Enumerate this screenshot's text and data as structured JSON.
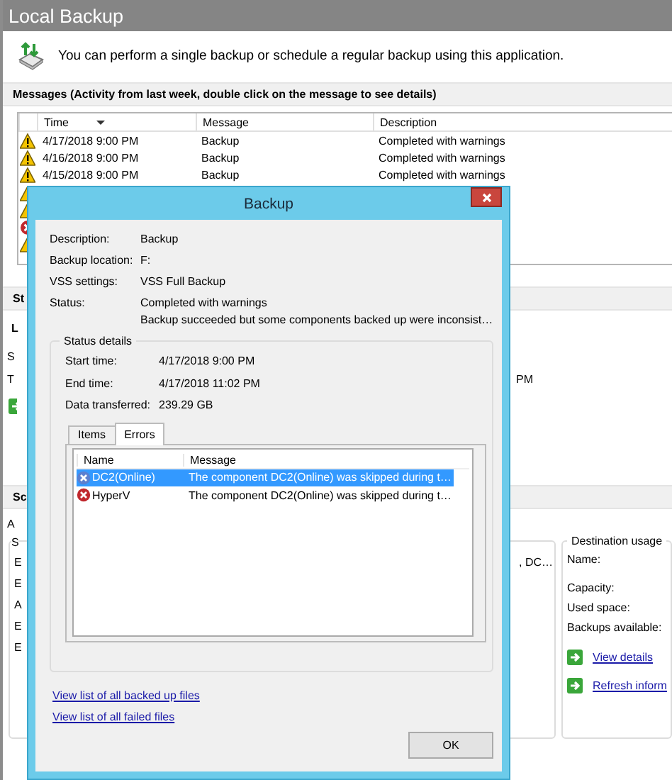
{
  "window": {
    "title": "Local Backup"
  },
  "header": {
    "text": "You can perform a single backup or schedule a regular backup using this application."
  },
  "messages": {
    "heading": "Messages (Activity from last week, double click on the message to see details)",
    "columns": [
      {
        "label": "Time",
        "sorted": true
      },
      {
        "label": "Message",
        "sorted": false
      },
      {
        "label": "Description",
        "sorted": false
      }
    ],
    "rows": [
      {
        "kind": "warning",
        "time": "4/17/2018 9:00 PM",
        "message": "Backup",
        "description": "Completed with warnings"
      },
      {
        "kind": "warning",
        "time": "4/16/2018 9:00 PM",
        "message": "Backup",
        "description": "Completed with warnings"
      },
      {
        "kind": "warning",
        "time": "4/15/2018 9:00 PM",
        "message": "Backup",
        "description": "Completed with warnings"
      },
      {
        "kind": "warning"
      },
      {
        "kind": "warning"
      },
      {
        "kind": "error"
      },
      {
        "kind": "warning"
      }
    ]
  },
  "status_section": {
    "heading": "St",
    "lines": [
      "L",
      "S",
      "T"
    ],
    "reading": "PM"
  },
  "scheduled_section": {
    "heading": "Sc",
    "line": "A",
    "group_lines": [
      "S",
      "E",
      "E",
      "A",
      "E",
      "E"
    ],
    "reading": ", DC…"
  },
  "destination": {
    "title": "Destination usage",
    "fields": [
      "Name:",
      "Capacity:",
      "Used space:",
      "Backups available:"
    ],
    "links": [
      "View details",
      "Refresh inform"
    ]
  },
  "dialog": {
    "title": "Backup",
    "fields": [
      {
        "label": "Description:",
        "value": "Backup"
      },
      {
        "label": "Backup location:",
        "value": "F:"
      },
      {
        "label": "VSS settings:",
        "value": "VSS Full Backup"
      },
      {
        "label": "Status:",
        "value": "Completed with warnings",
        "detail": "Backup succeeded but some components backed up were inconsist…"
      }
    ],
    "status_details": {
      "title": "Status details",
      "fields": [
        {
          "label": "Start time:",
          "value": "4/17/2018 9:00 PM"
        },
        {
          "label": "End time:",
          "value": "4/17/2018 11:02 PM"
        },
        {
          "label": "Data transferred:",
          "value": "239.29 GB"
        }
      ],
      "tabs": [
        {
          "label": "Items",
          "selected": false
        },
        {
          "label": "Errors",
          "selected": true
        }
      ],
      "columns": [
        "Name",
        "Message"
      ],
      "rows": [
        {
          "name": "DC2(Online)",
          "message": "The component DC2(Online) was skipped during t…",
          "selected": true
        },
        {
          "name": "HyperV",
          "message": "The component DC2(Online) was skipped during t…",
          "selected": false
        }
      ]
    },
    "links": [
      "View list of all backed up files",
      "View list of all failed files"
    ],
    "buttons": [
      "OK"
    ]
  }
}
